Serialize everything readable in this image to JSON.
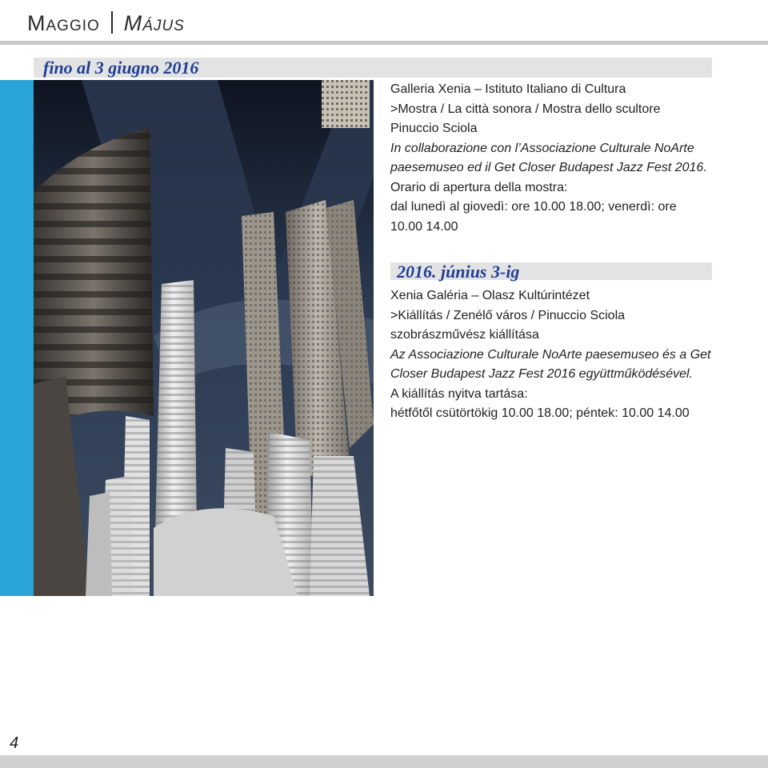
{
  "header": {
    "it": "Maggio",
    "hu": "Május"
  },
  "italian": {
    "date": "fino al 3 giugno 2016",
    "venue": "Galleria Xenia – Istituto Italiano di Cultura",
    "title1": ">Mostra / La città sonora / Mostra dello scultore",
    "title2": "Pinuccio Sciola",
    "collab1": "In collaborazione con l’Associazione Culturale NoArte",
    "collab2": "paesemuseo ed il Get Closer Budapest Jazz Fest 2016.",
    "hours1": "Orario di apertura della mostra:",
    "hours2": "dal lunedì al giovedì: ore 10.00 18.00; venerdì: ore",
    "hours3": "10.00 14.00"
  },
  "hungarian": {
    "date": "2016. június 3-ig",
    "venue": "Xenia Galéria – Olasz Kultúrintézet",
    "title1": ">Kiállítás / Zenélő város / Pinuccio Sciola",
    "title2": "szobrászművész kiállítása",
    "collab1": "Az Associazione Culturale NoArte paesemuseo és a Get",
    "collab2": "Closer Budapest Jazz Fest 2016 együttműködésével.",
    "hours1": "A kiállítás nyitva tartása:",
    "hours2": "hétfőtől csütörtökig 10.00 18.00; péntek: 10.00 14.00"
  },
  "page_number": "4",
  "colors": {
    "accent_blue": "#2aa3d6",
    "date_blue": "#1f3f95",
    "band_gray": "#e3e3e3"
  }
}
